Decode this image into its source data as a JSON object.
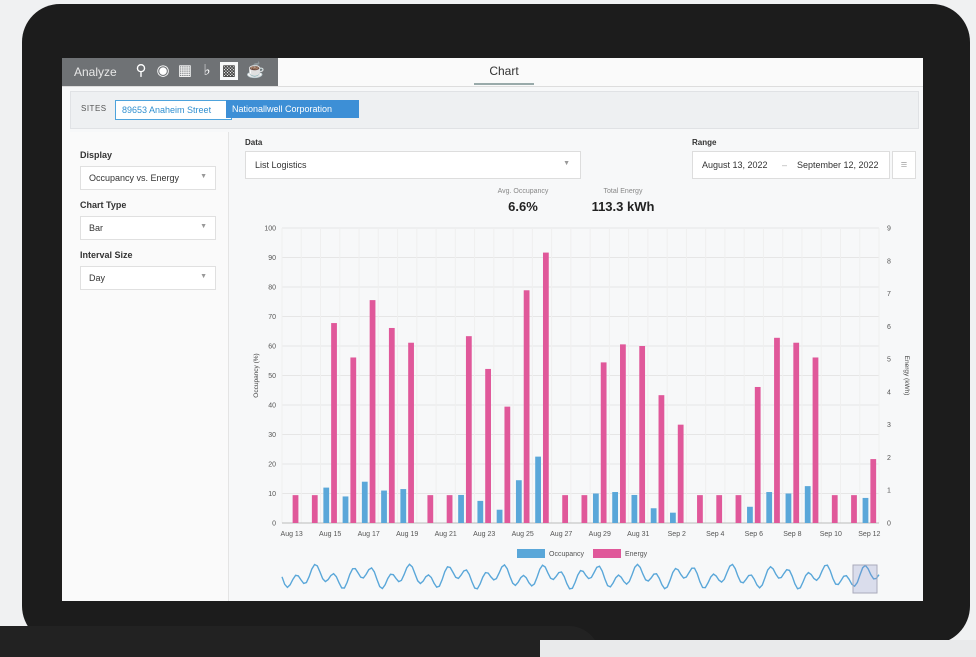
{
  "topbar": {
    "analyze_label": "Analyze",
    "icons": [
      "location-pin-icon",
      "map-marker-icon",
      "grid-icon",
      "bell-icon",
      "bar-chart-icon",
      "pot-icon"
    ],
    "chart_tab": "Chart"
  },
  "sites": {
    "label": "SITES",
    "chips": [
      "89653 Anaheim Street",
      "Nationallwell Corporation"
    ]
  },
  "sidebar": {
    "display_label": "Display",
    "display_value": "Occupancy vs. Energy",
    "chart_type_label": "Chart Type",
    "chart_type_value": "Bar",
    "interval_label": "Interval Size",
    "interval_value": "Day"
  },
  "data": {
    "label": "Data",
    "value": "List Logistics"
  },
  "range": {
    "label": "Range",
    "start": "August 13, 2022",
    "separator": "–",
    "end": "September 12, 2022"
  },
  "stats": {
    "avg_occupancy_label": "Avg. Occupancy",
    "avg_occupancy_value": "6.6%",
    "total_energy_label": "Total Energy",
    "total_energy_value": "113.3 kWh"
  },
  "colors": {
    "occupancy": "#5aa7d9",
    "energy": "#e0589a",
    "accent": "#3d8fd6"
  },
  "chart_data": {
    "type": "bar",
    "categories": [
      "Aug 13",
      "Aug 14",
      "Aug 15",
      "Aug 16",
      "Aug 17",
      "Aug 18",
      "Aug 19",
      "Aug 20",
      "Aug 21",
      "Aug 22",
      "Aug 23",
      "Aug 24",
      "Aug 25",
      "Aug 26",
      "Aug 27",
      "Aug 28",
      "Aug 29",
      "Aug 30",
      "Aug 31",
      "Sep 1",
      "Sep 2",
      "Sep 3",
      "Sep 4",
      "Sep 5",
      "Sep 6",
      "Sep 7",
      "Sep 8",
      "Sep 9",
      "Sep 10",
      "Sep 11",
      "Sep 12"
    ],
    "x_tick_labels": [
      "Aug 13",
      "Aug 15",
      "Aug 17",
      "Aug 19",
      "Aug 21",
      "Aug 23",
      "Aug 25",
      "Aug 27",
      "Aug 29",
      "Aug 31",
      "Sep 2",
      "Sep 4",
      "Sep 6",
      "Sep 8",
      "Sep 10",
      "Sep 12"
    ],
    "series": [
      {
        "name": "Occupancy",
        "axis": "left",
        "values": [
          0,
          0,
          12,
          9,
          14,
          11,
          11.5,
          0,
          0,
          9.5,
          7.5,
          4.5,
          14.5,
          22.5,
          0,
          0,
          10,
          10.5,
          9.5,
          5,
          3.5,
          0,
          0,
          0,
          5.5,
          10.5,
          10,
          12.5,
          0,
          0,
          8.5
        ]
      },
      {
        "name": "Energy",
        "axis": "right",
        "values": [
          0.85,
          0.85,
          6.1,
          5.05,
          6.8,
          5.95,
          5.5,
          0.85,
          0.85,
          5.7,
          4.7,
          3.55,
          7.1,
          8.25,
          0.85,
          0.85,
          4.9,
          5.45,
          5.4,
          3.9,
          3,
          0.85,
          0.85,
          0.85,
          4.15,
          5.65,
          5.5,
          5.05,
          0.85,
          0.85,
          1.95
        ]
      }
    ],
    "ylabel": "Occupancy (%)",
    "y2label": "Energy (kWh)",
    "ylim": [
      0,
      100
    ],
    "y2lim": [
      0,
      9
    ],
    "y_ticks": [
      0,
      10,
      20,
      30,
      40,
      50,
      60,
      70,
      80,
      90,
      100
    ],
    "y2_ticks": [
      0,
      1,
      2,
      3,
      4,
      5,
      6,
      7,
      8,
      9
    ],
    "grid": true,
    "legend": [
      "Occupancy",
      "Energy"
    ],
    "legend_position": "bottom"
  }
}
